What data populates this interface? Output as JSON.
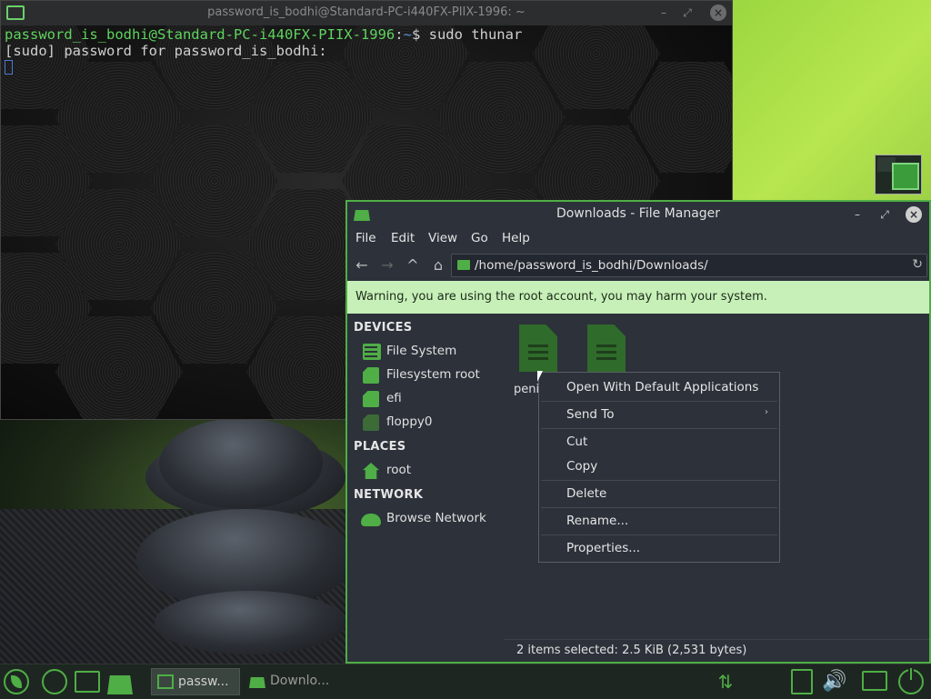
{
  "terminal": {
    "title": "password_is_bodhi@Standard-PC-i440FX-PIIX-1996: ~",
    "prompt_user": "password_is_bodhi@Standard-PC-i440FX-PIIX-1996",
    "prompt_sep": ":",
    "prompt_path": "~",
    "prompt_dollar": "$ ",
    "command": "sudo thunar",
    "line2": "[sudo] password for password_is_bodhi:",
    "controls": {
      "minimize": "–",
      "maximize": "⤢",
      "close": "×"
    }
  },
  "file_manager": {
    "title": "Downloads - File Manager",
    "controls": {
      "minimize": "–",
      "maximize": "⤢",
      "close": "×"
    },
    "menu": [
      "File",
      "Edit",
      "View",
      "Go",
      "Help"
    ],
    "nav": {
      "back": "←",
      "forward": "→",
      "up": "^",
      "home": "⌂",
      "reload": "↻"
    },
    "path": "/home/password_is_bodhi/Downloads/",
    "warning": "Warning, you are using the root account, you may harm your system.",
    "sidebar": {
      "devices_heading": "DEVICES",
      "devices": [
        "File System",
        "Filesystem root",
        "efi",
        "floppy0"
      ],
      "places_heading": "PLACES",
      "places": [
        "root"
      ],
      "network_heading": "NETWORK",
      "network": [
        "Browse Network"
      ]
    },
    "files": [
      {
        "label": "peni",
        "icon": "document-icon"
      },
      {
        "label": "",
        "icon": "document-icon"
      }
    ],
    "status": "2 items selected: 2.5 KiB (2,531 bytes)"
  },
  "context_menu": {
    "items": [
      "Open With Default Applications",
      "Send To",
      "Cut",
      "Copy",
      "Delete",
      "Rename...",
      "Properties..."
    ],
    "submenu_arrow": "›"
  },
  "taskbar": {
    "tasks": [
      {
        "label": "passw..."
      },
      {
        "label": "Downlo..."
      }
    ],
    "net_glyph": "⇅",
    "vol_glyph": "🔊"
  },
  "colors": {
    "accent": "#4fae45",
    "warning_bg": "#c7f0b9",
    "panel_bg": "#2c313a"
  }
}
